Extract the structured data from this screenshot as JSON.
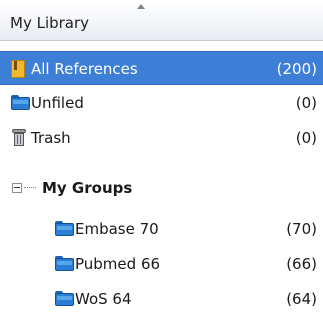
{
  "header": {
    "title": "My Library"
  },
  "library_items": [
    {
      "label": "All References",
      "count": "(200)",
      "icon": "library-book-icon",
      "selected": true
    },
    {
      "label": "Unfiled",
      "count": "(0)",
      "icon": "folder-icon"
    },
    {
      "label": "Trash",
      "count": "(0)",
      "icon": "trash-icon"
    }
  ],
  "groups": {
    "label": "My Groups",
    "items": [
      {
        "label": "Embase 70",
        "count": "(70)",
        "icon": "folder-icon"
      },
      {
        "label": "Pubmed 66",
        "count": "(66)",
        "icon": "folder-icon"
      },
      {
        "label": "WoS 64",
        "count": "(64)",
        "icon": "folder-icon"
      }
    ]
  },
  "colors": {
    "selection": "#3d7ed6",
    "folder": "#2a7fd4",
    "library": "#f2b82e"
  }
}
